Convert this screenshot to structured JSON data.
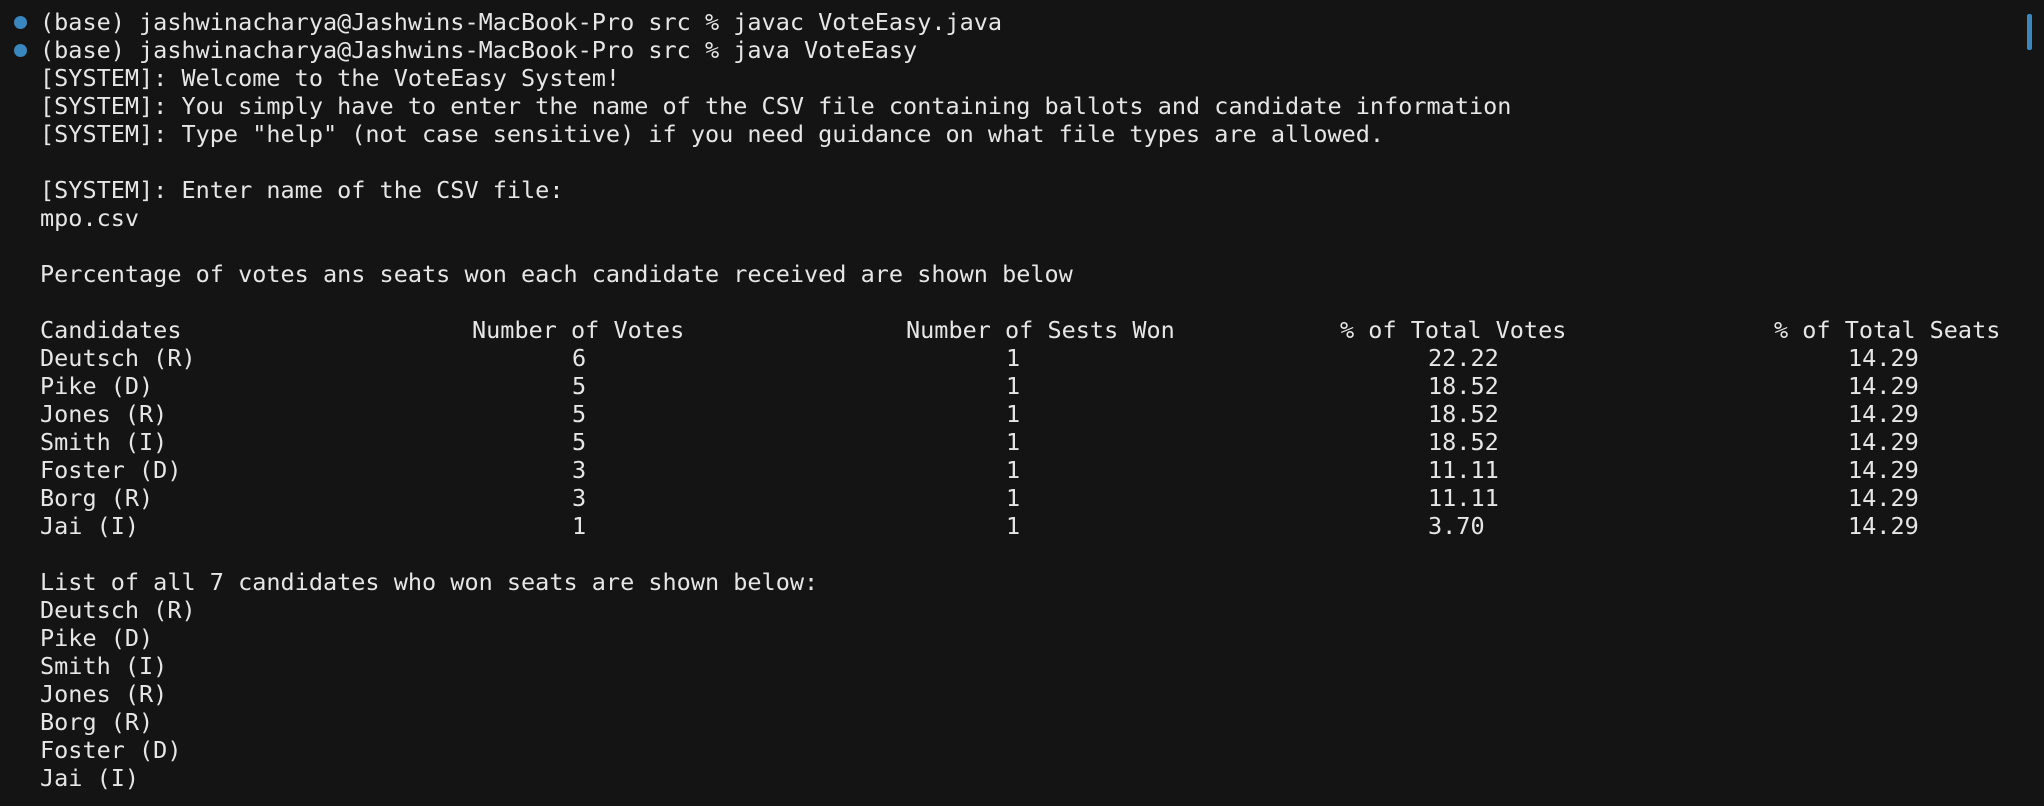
{
  "commands": [
    {
      "prompt": "(base) jashwinacharya@Jashwins-MacBook-Pro src % ",
      "command": "javac VoteEasy.java"
    },
    {
      "prompt": "(base) jashwinacharya@Jashwins-MacBook-Pro src % ",
      "command": "java VoteEasy"
    }
  ],
  "output": {
    "welcome": "[SYSTEM]: Welcome to the VoteEasy System!",
    "instructions": "[SYSTEM]: You simply have to enter the name of the CSV file containing ballots and candidate information",
    "help_hint": "[SYSTEM]: Type \"help\" (not case sensitive) if you need guidance on what file types are allowed.",
    "enter_prompt": "[SYSTEM]: Enter name of the CSV file:",
    "user_input": "mpo.csv",
    "results_intro": "Percentage of votes ans seats won each candidate received are shown below",
    "table": {
      "headers": [
        "Candidates",
        "Number of Votes",
        "Number of Sests Won",
        "% of Total Votes",
        "% of Total Seats"
      ],
      "rows": [
        [
          "Deutsch (R)",
          "6",
          "1",
          "22.22",
          "14.29"
        ],
        [
          "Pike (D)",
          "5",
          "1",
          "18.52",
          "14.29"
        ],
        [
          "Jones (R)",
          "5",
          "1",
          "18.52",
          "14.29"
        ],
        [
          "Smith (I)",
          "5",
          "1",
          "18.52",
          "14.29"
        ],
        [
          "Foster (D)",
          "3",
          "1",
          "11.11",
          "14.29"
        ],
        [
          "Borg (R)",
          "3",
          "1",
          "11.11",
          "14.29"
        ],
        [
          "Jai (I)",
          "1",
          "1",
          "3.70",
          "14.29"
        ]
      ]
    },
    "winners_intro": "List of all 7 candidates who won seats are shown below:",
    "winners": [
      "Deutsch (R)",
      "Pike (D)",
      "Smith (I)",
      "Jones (R)",
      "Borg (R)",
      "Foster (D)",
      "Jai (I)"
    ]
  },
  "colors": {
    "background": "#141414",
    "text": "#e6e6e6",
    "command_dot": "#3a86bf"
  }
}
